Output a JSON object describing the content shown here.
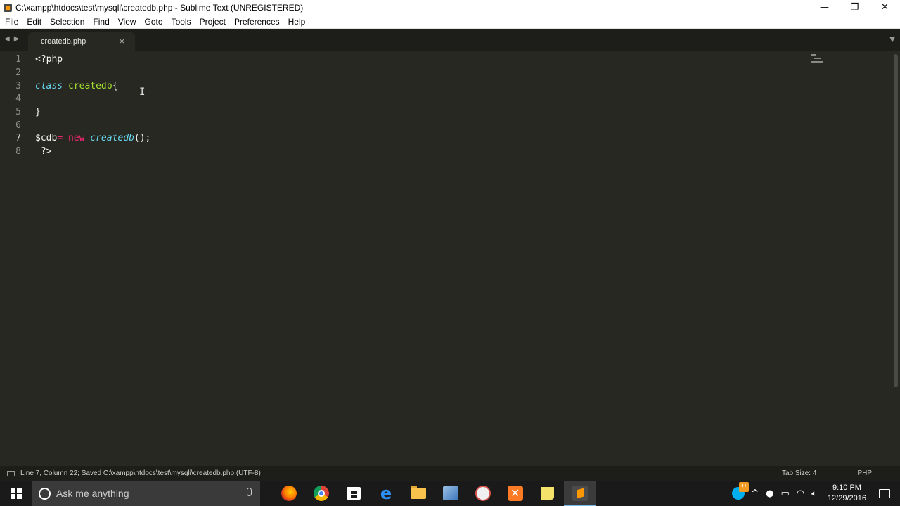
{
  "window": {
    "title": "C:\\xampp\\htdocs\\test\\mysqli\\createdb.php - Sublime Text (UNREGISTERED)",
    "minimize": "—",
    "restore": "❐",
    "close": "✕"
  },
  "menu": [
    "File",
    "Edit",
    "Selection",
    "Find",
    "View",
    "Goto",
    "Tools",
    "Project",
    "Preferences",
    "Help"
  ],
  "tabs": [
    {
      "label": "createdb.php",
      "close": "×",
      "active": true
    }
  ],
  "editor": {
    "line_numbers": [
      "1",
      "2",
      "3",
      "4",
      "5",
      "6",
      "7",
      "8"
    ],
    "active_line": 7,
    "lines": {
      "l1": "<?php",
      "l3_kw": "class",
      "l3_name": "createdb",
      "l3_brace": "{",
      "l5": "}",
      "l7_var": "$cdb",
      "l7_eq": "=",
      "l7_new": "new",
      "l7_fn": "createdb",
      "l7_tail": "();",
      "l8": " ?>"
    },
    "syntax_colors": {
      "default": "#f8f8f2",
      "storage": "#66d9ef",
      "class_name": "#a6e22e",
      "operator": "#f92672",
      "background": "#272822"
    }
  },
  "status": {
    "left": "Line 7, Column 22; Saved C:\\xampp\\htdocs\\test\\mysqli\\createdb.php (UTF-8)",
    "tab_size": "Tab Size: 4",
    "syntax": "PHP"
  },
  "taskbar": {
    "search_placeholder": "Ask me anything",
    "apps": [
      "firefox-icon",
      "chrome-icon",
      "store-icon",
      "edge-icon",
      "file-explorer-icon",
      "network-icon",
      "adobe-icon",
      "xampp-icon",
      "sticky-notes-icon",
      "sublime-text-icon"
    ],
    "active_app": "sublime-text-icon",
    "skype_badge": "!!",
    "clock_time": "9:10 PM",
    "clock_date": "12/29/2016"
  }
}
